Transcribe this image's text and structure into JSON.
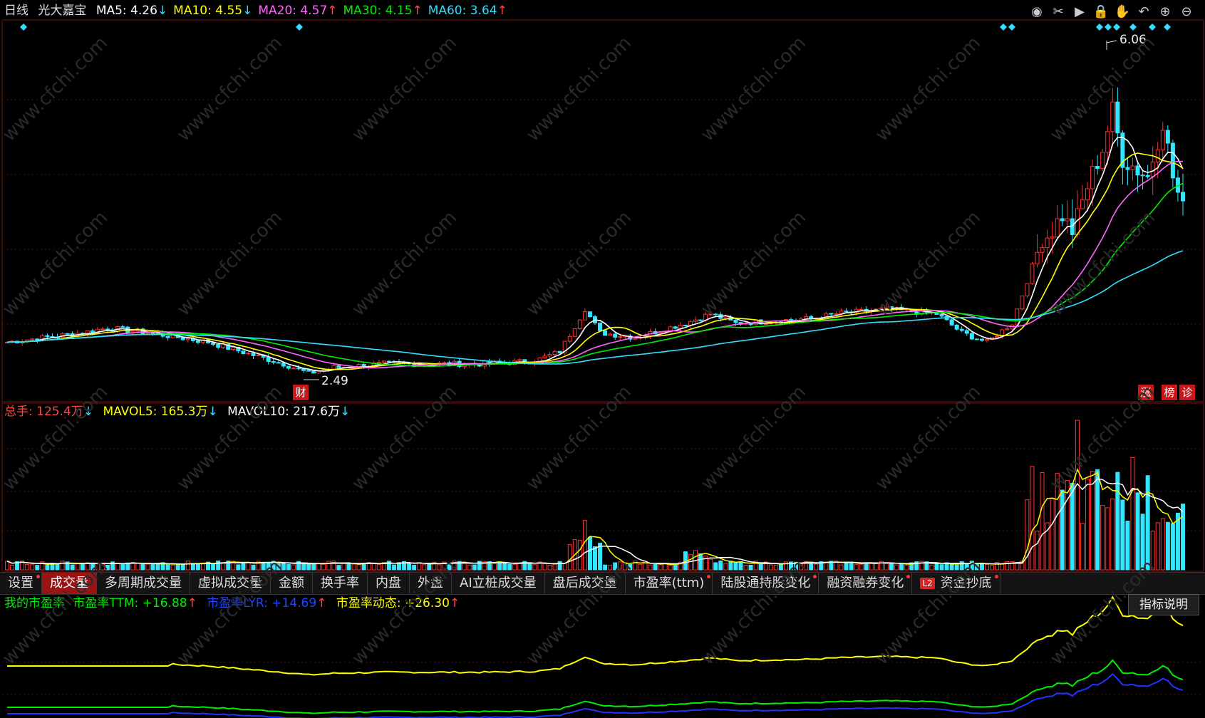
{
  "main": {
    "period": "日线",
    "stock_name": "光大嘉宝",
    "ma": [
      {
        "label": "MA5: 4.26",
        "arrow": "↓",
        "color": "#ffffff"
      },
      {
        "label": "MA10: 4.55",
        "arrow": "↓",
        "color": "#ffff00"
      },
      {
        "label": "MA20: 4.57",
        "arrow": "↑",
        "color": "#ff66ff"
      },
      {
        "label": "MA30: 4.15",
        "arrow": "↑",
        "color": "#00ee00"
      },
      {
        "label": "MA60: 3.64",
        "arrow": "↑",
        "color": "#33ddff"
      }
    ],
    "high_label": "6.06",
    "low_label": "2.49",
    "fin_badge": "财",
    "badges": [
      "涨",
      "榜",
      "诊"
    ]
  },
  "toolbar": {
    "icons": [
      "eye-icon",
      "scissors-icon",
      "play-icon",
      "lock-icon",
      "hand-icon",
      "undo-icon",
      "zoom-in-icon",
      "zoom-out-icon"
    ]
  },
  "volume": {
    "label_total": "总手: 125.4万",
    "label_total_arrow": "↓",
    "label_mavol5": "MAVOL5: 165.3万",
    "label_mavol5_arrow": "↓",
    "label_mavol10": "MAVOL10: 217.6万",
    "label_mavol10_arrow": "↓"
  },
  "tabs": [
    {
      "label": "设置",
      "dot": true
    },
    {
      "label": "成交量",
      "active": true
    },
    {
      "label": "多周期成交量"
    },
    {
      "label": "虚拟成交量"
    },
    {
      "label": "金额"
    },
    {
      "label": "换手率"
    },
    {
      "label": "内盘"
    },
    {
      "label": "外盘"
    },
    {
      "label": "AI立桩成交量"
    },
    {
      "label": "盘后成交量"
    },
    {
      "label": "市盈率(ttm)",
      "dot": true
    },
    {
      "label": "陆股通持股变化",
      "dot": true
    },
    {
      "label": "融资融券变化",
      "dot": true
    },
    {
      "label": "资金抄底",
      "dot": true,
      "l2": "L2"
    }
  ],
  "pe": {
    "title": "我的市盈率",
    "ttm": "市盈率TTM: +16.88",
    "ttm_arrow": "↑",
    "lyr": "市盈率LYR: +14.69",
    "lyr_arrow": "↑",
    "dyn": "市盈率动态: +26.30",
    "dyn_arrow": "↑",
    "explain_button": "指标说明"
  },
  "chart_data": {
    "type": "candlestick",
    "price_high": 6.06,
    "price_low": 2.49,
    "last_ma": {
      "MA5": 4.26,
      "MA10": 4.55,
      "MA20": 4.57,
      "MA30": 4.15,
      "MA60": 3.64
    },
    "last_volume_wan": 125.4,
    "mavol5_wan": 165.3,
    "mavol10_wan": 217.6,
    "pe_ttm": 16.88,
    "pe_lyr": 14.69,
    "pe_dynamic": 26.3
  },
  "watermark": "www.cfchi.com"
}
